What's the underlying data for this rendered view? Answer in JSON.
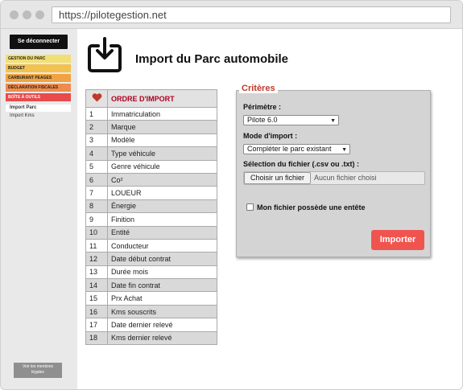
{
  "browser": {
    "url": "https://pilotegestion.net"
  },
  "sidebar": {
    "logout_label": "Se déconnecter",
    "menu": [
      {
        "label": "GESTION DU PARC",
        "color": "#f2df73"
      },
      {
        "label": "BUDGET",
        "color": "#f2c14e"
      },
      {
        "label": "CARBURANT PEAGES",
        "color": "#f0a340"
      },
      {
        "label": "DÉCLARATION FISCALES",
        "color": "#ef8c4d"
      },
      {
        "label": "BOÎTE À OUTILS",
        "color": "#e84b4b"
      }
    ],
    "submenu": [
      {
        "label": "Import Parc"
      },
      {
        "label": "Import Kms"
      }
    ],
    "legal_line1": "Voir les mentions",
    "legal_line2": "légales"
  },
  "main": {
    "title": "Import du Parc automobile",
    "icon": "import-tray-icon"
  },
  "table": {
    "header_icon": "heart-icon",
    "header_icon_color": "#c0392b",
    "header_label": "ORDRE D'IMPORT",
    "rows": [
      {
        "num": "1",
        "field": "Immatriculation"
      },
      {
        "num": "2",
        "field": "Marque"
      },
      {
        "num": "3",
        "field": "Modèle"
      },
      {
        "num": "4",
        "field": "Type véhicule"
      },
      {
        "num": "5",
        "field": "Genre véhicule"
      },
      {
        "num": "6",
        "field": "Co²"
      },
      {
        "num": "7",
        "field": "LOUEUR"
      },
      {
        "num": "8",
        "field": "Énergie"
      },
      {
        "num": "9",
        "field": "Finition"
      },
      {
        "num": "10",
        "field": "Entité"
      },
      {
        "num": "11",
        "field": "Conducteur"
      },
      {
        "num": "12",
        "field": "Date début contrat"
      },
      {
        "num": "13",
        "field": "Durée mois"
      },
      {
        "num": "14",
        "field": "Date fin contrat"
      },
      {
        "num": "15",
        "field": "Prx Achat"
      },
      {
        "num": "16",
        "field": "Kms souscrits"
      },
      {
        "num": "17",
        "field": "Date dernier relevé"
      },
      {
        "num": "18",
        "field": "Kms dernier relevé"
      }
    ]
  },
  "criteria": {
    "legend": "Critères",
    "perimetre_label": "Périmètre :",
    "perimetre_value": "Pilote 6.0",
    "mode_label": "Mode d'import :",
    "mode_value": "Compléter le parc existant",
    "file_label": "Sélection du fichier (.csv ou .txt) :",
    "file_button": "Choisir un fichier",
    "file_status": "Aucun fichier choisi",
    "header_checkbox_label": "Mon fichier possède une entête",
    "header_checkbox_checked": false,
    "import_button": "Importer",
    "import_button_color": "#f0544f"
  }
}
